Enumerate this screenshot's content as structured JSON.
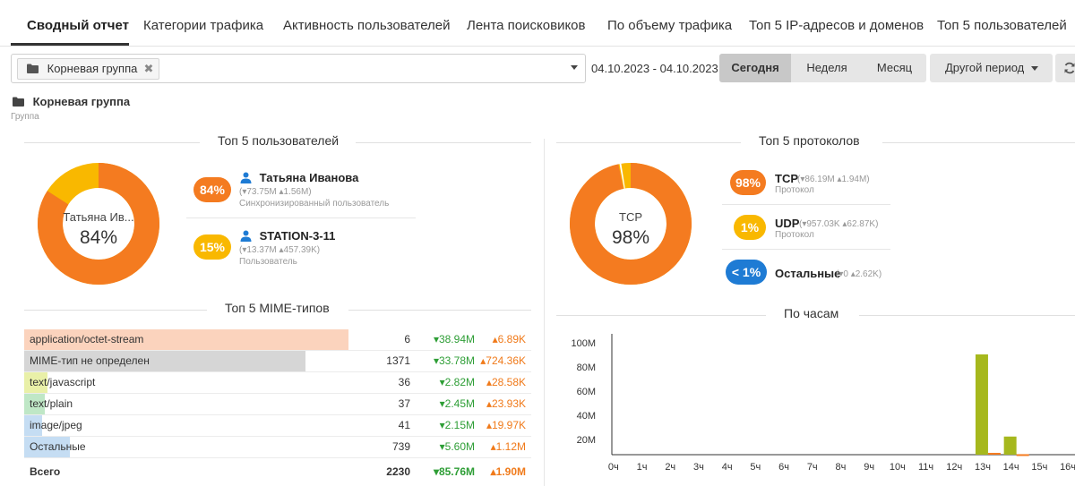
{
  "tabs": [
    {
      "label": "Сводный отчет",
      "active": true
    },
    {
      "label": "Категории трафика"
    },
    {
      "label": "Активность пользователей"
    },
    {
      "label": "Лента поисковиков"
    },
    {
      "label": "По объему трафика"
    },
    {
      "label": "Топ 5 IP-адресов и доменов"
    },
    {
      "label": "Топ 5 пользователей"
    }
  ],
  "toolbar": {
    "group_chip": "Корневая группа",
    "chip_remove": "✖",
    "date_range": "04.10.2023 - 04.10.2023",
    "periods": [
      "Сегодня",
      "Неделя",
      "Месяц"
    ],
    "active_period": "Сегодня",
    "other_period": "Другой период"
  },
  "group": {
    "title": "Корневая группа",
    "subtitle": "Группа"
  },
  "top_users": {
    "title": "Топ 5 пользователей",
    "center_name": "Татьяна Ив...",
    "center_pct": "84%",
    "items": [
      {
        "pct": "84%",
        "name": "Татьяна Иванова",
        "stats": "(▾73.75M ▴1.56M)",
        "sub": "Синхронизированный пользователь",
        "color": "#f47b20"
      },
      {
        "pct": "15%",
        "name": "STATION-3-11",
        "stats": "(▾13.37M ▴457.39K)",
        "sub": "Пользователь",
        "color": "#f9b800"
      }
    ]
  },
  "top_protocols": {
    "title": "Топ 5 протоколов",
    "center_name": "TCP",
    "center_pct": "98%",
    "items": [
      {
        "pct": "98%",
        "name": "TCP",
        "stats": "(▾86.19M ▴1.94M)",
        "sub": "Протокол",
        "color": "#f47b20"
      },
      {
        "pct": "1%",
        "name": "UDP",
        "stats": "(▾957.03K ▴62.87K)",
        "sub": "Протокол",
        "color": "#f9b800"
      },
      {
        "pct": "< 1%",
        "name": "Остальные",
        "stats": "(▾0 ▴2.62K)",
        "sub": "",
        "color": "#1e7bd4"
      }
    ]
  },
  "mime": {
    "title": "Топ 5 MIME-типов",
    "rows": [
      {
        "label": "application/octet-stream",
        "count": "6",
        "down": "▾38.94M",
        "up": "▴6.89K",
        "bar": 0.64,
        "color": "#fbd3bd"
      },
      {
        "label": "MIME-тип не определен",
        "count": "1371",
        "down": "▾33.78M",
        "up": "▴724.36K",
        "bar": 0.555,
        "color": "#d6d6d6"
      },
      {
        "label": "text/javascript",
        "count": "36",
        "down": "▾2.82M",
        "up": "▴28.58K",
        "bar": 0.046,
        "color": "#e9f0a8"
      },
      {
        "label": "text/plain",
        "count": "37",
        "down": "▾2.45M",
        "up": "▴23.93K",
        "bar": 0.04,
        "color": "#bfe7c6"
      },
      {
        "label": "image/jpeg",
        "count": "41",
        "down": "▾2.15M",
        "up": "▴19.97K",
        "bar": 0.035,
        "color": "#c5ddf3"
      },
      {
        "label": "Остальные",
        "count": "739",
        "down": "▾5.60M",
        "up": "▴1.12M",
        "bar": 0.09,
        "color": "#c5ddf3"
      }
    ],
    "total": {
      "label": "Всего",
      "count": "2230",
      "down": "▾85.76M",
      "up": "▴1.90M"
    }
  },
  "chart_data": {
    "type": "bar",
    "title": "По часам",
    "categories": [
      "0ч",
      "1ч",
      "2ч",
      "3ч",
      "4ч",
      "5ч",
      "6ч",
      "7ч",
      "8ч",
      "9ч",
      "10ч",
      "11ч",
      "12ч",
      "13ч",
      "14ч",
      "15ч",
      "16ч"
    ],
    "y_ticks": [
      "20M",
      "40M",
      "60M",
      "80M",
      "100M"
    ],
    "ylim": [
      0,
      100
    ],
    "series": [
      {
        "color": "#a6b81d",
        "values": [
          0,
          0,
          0,
          0,
          0,
          0,
          0,
          0,
          0,
          0,
          0,
          0,
          0,
          83,
          15,
          0,
          0
        ]
      },
      {
        "color": "#f47b20",
        "values": [
          0,
          0,
          0,
          0,
          0,
          0,
          0,
          0,
          0,
          0,
          0,
          0,
          0,
          1.5,
          0.4,
          0,
          0
        ]
      }
    ]
  },
  "colors": {
    "orange": "#f47b20",
    "yellow": "#f9b800",
    "blue": "#1e7bd4",
    "green": "#2e9e36",
    "olive": "#a6b81d"
  }
}
